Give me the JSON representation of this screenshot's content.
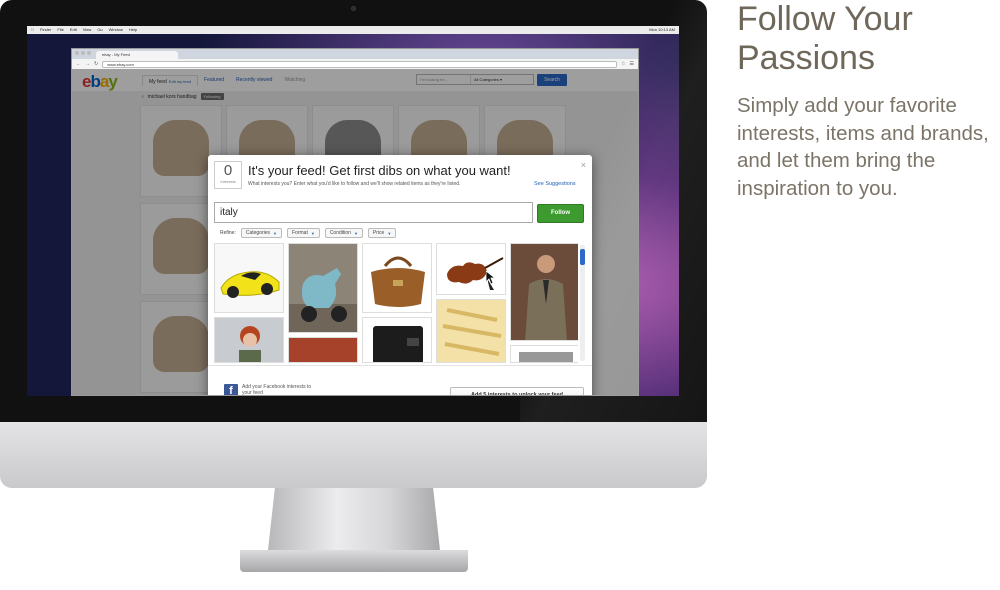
{
  "promo": {
    "title": "Follow Your Passions",
    "body": "Simply add your favorite interests, items and brands, and let them bring the inspiration to you."
  },
  "mac_menubar": {
    "items": [
      "Finder",
      "File",
      "Edit",
      "View",
      "Go",
      "Window",
      "Help"
    ],
    "clock": "Mon 10:13 AM"
  },
  "browser": {
    "tab_title": "ebay - My Feed",
    "url": "www.ebay.com"
  },
  "ebay": {
    "nav": {
      "my_feed": "My feed",
      "edit_my_feed": "Edit my feed",
      "featured": "Featured",
      "recently_viewed": "Recently viewed",
      "watching": "Watching"
    },
    "search": {
      "placeholder": "I'm looking for...",
      "category": "All Categories",
      "button": "Search"
    },
    "breadcrumb": {
      "query": "michael kors handbag",
      "status": "Following"
    },
    "bg_tiles": [
      {
        "tag": "",
        "dark": false
      },
      {
        "tag": "",
        "dark": false
      },
      {
        "tag": "",
        "dark": true
      },
      {
        "tag": "",
        "dark": false
      },
      {
        "tag": "",
        "dark": false
      },
      {
        "tag": "",
        "dark": false
      },
      {
        "tag": "",
        "dark": false
      },
      {
        "tag": "",
        "dark": false
      },
      {
        "tag": "",
        "dark": true
      },
      {
        "tag": "",
        "dark": false
      },
      {
        "tag": "",
        "dark": false
      },
      {
        "tag": "",
        "dark": true
      },
      {
        "tag": "",
        "dark": false
      },
      {
        "tag": "",
        "dark": false
      },
      {
        "tag": "",
        "dark": false
      }
    ]
  },
  "modal": {
    "count": "0",
    "count_label": "Interests",
    "title": "It's your feed! Get first dibs on what you want!",
    "subtitle": "What interests you? Enter what you'd like to follow and we'll show related items as they're listed.",
    "suggestions_link": "See Suggestions",
    "query": "italy",
    "follow_button": "Follow",
    "refine_label": "Refine:",
    "filters": [
      "Categories",
      "Format",
      "Condition",
      "Price"
    ],
    "facebook_text": "Add your Facebook interests to your feed",
    "unlock_button": "Add 5 interests to unlock your feed"
  },
  "colors": {
    "ebay_blue": "#2d69c8",
    "follow_green": "#3c9a2e",
    "facebook_blue": "#3b5998",
    "promo_text": "#6f6759"
  }
}
